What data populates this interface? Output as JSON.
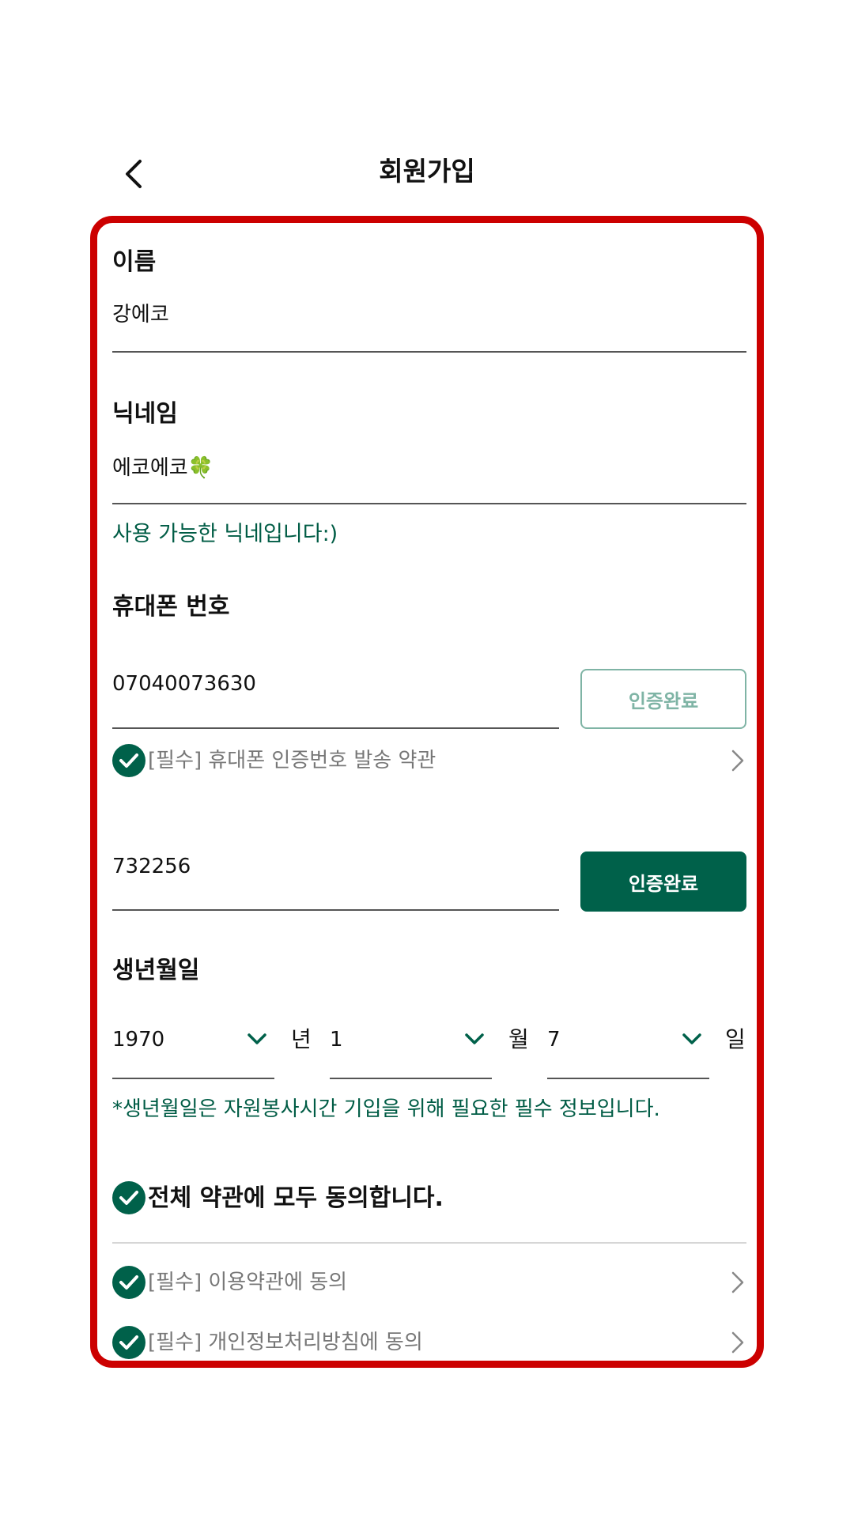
{
  "header": {
    "title": "회원가입",
    "back_icon": "chevron-left-icon"
  },
  "form": {
    "name": {
      "label": "이름",
      "value": "강에코"
    },
    "nickname": {
      "label": "닉네임",
      "value": "에코에코🍀",
      "message": "사용 가능한 닉네입니다:)"
    },
    "phone": {
      "label": "휴대폰 번호",
      "number": "07040073630",
      "number_button": "인증완료",
      "terms_label": "[필수] 휴대폰 인증번호 발송 약관",
      "code": "732256",
      "code_button": "인증완료"
    },
    "birth": {
      "label": "생년월일",
      "year": "1970",
      "year_unit": "년",
      "month": "1",
      "month_unit": "월",
      "day": "7",
      "day_unit": "일",
      "note": "*생년월일은 자원봉사시간 기입을 위해 필요한 필수 정보입니다."
    },
    "agreements": {
      "all_label": "전체 약관에 모두 동의합니다.",
      "items": [
        {
          "label": "[필수] 이용약관에 동의"
        },
        {
          "label": "[필수] 개인정보처리방침에 동의"
        }
      ]
    }
  },
  "colors": {
    "accent": "#00614a",
    "frame": "#cc0000",
    "outline_button": "#7fb4a5"
  }
}
